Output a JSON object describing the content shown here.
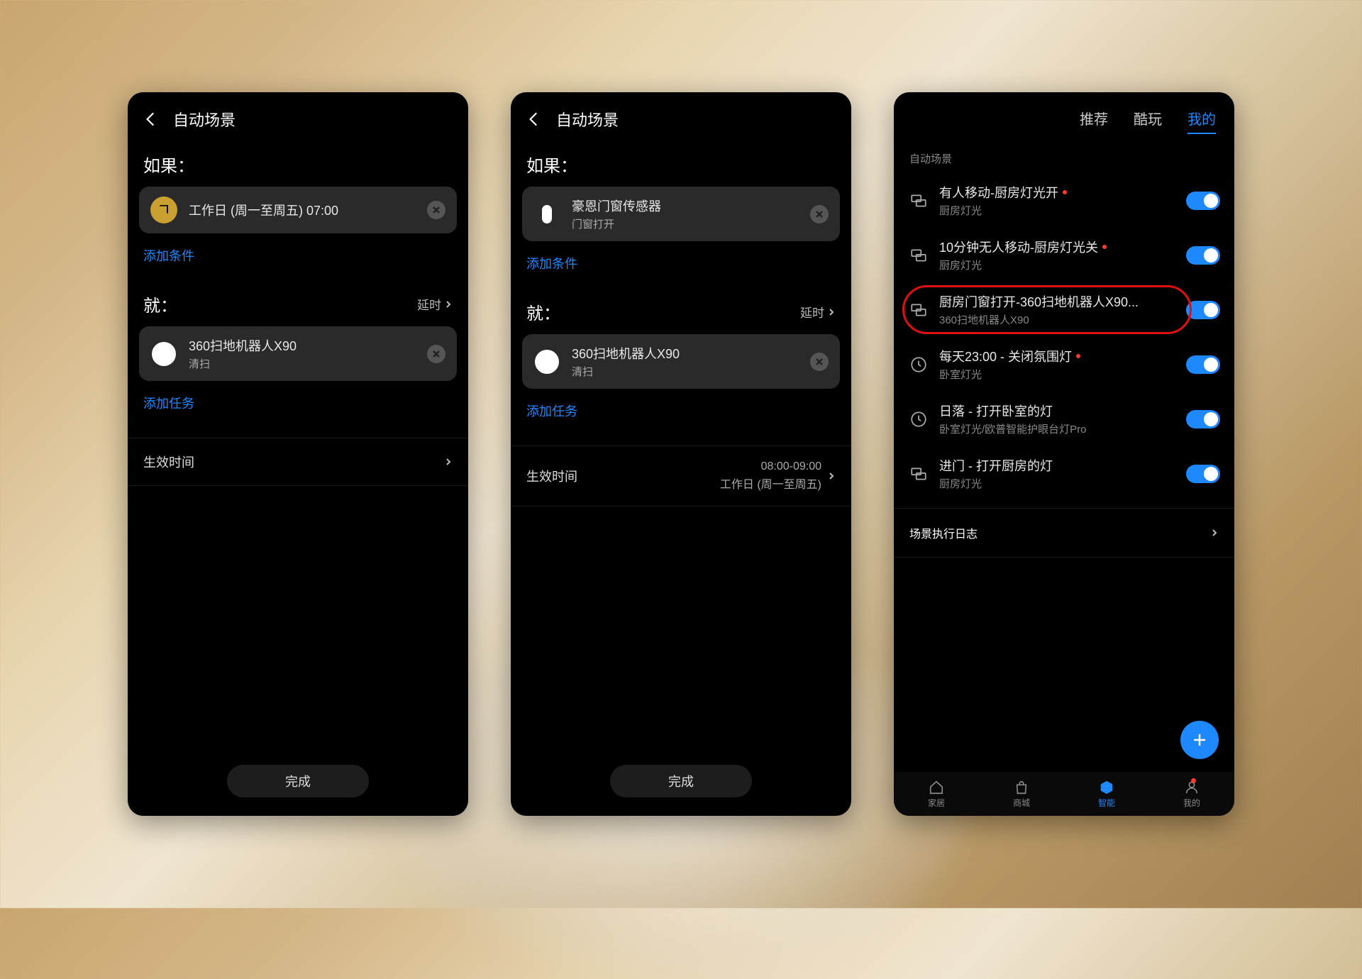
{
  "screen1": {
    "header": "自动场景",
    "if_label": "如果：",
    "condition": {
      "title": "工作日 (周一至周五) 07:00"
    },
    "add_condition": "添加条件",
    "then_label": "就：",
    "delay_label": "延时",
    "task": {
      "title": "360扫地机器人X90",
      "sub": "清扫"
    },
    "add_task": "添加任务",
    "effective_label": "生效时间",
    "done": "完成"
  },
  "screen2": {
    "header": "自动场景",
    "if_label": "如果：",
    "condition": {
      "title": "豪恩门窗传感器",
      "sub": "门窗打开"
    },
    "add_condition": "添加条件",
    "then_label": "就：",
    "delay_label": "延时",
    "task": {
      "title": "360扫地机器人X90",
      "sub": "清扫"
    },
    "add_task": "添加任务",
    "effective_label": "生效时间",
    "effective_time": "08:00-09:00",
    "effective_days": "工作日 (周一至周五)",
    "done": "完成"
  },
  "screen3": {
    "tabs": {
      "recommend": "推荐",
      "cool": "酷玩",
      "mine": "我的"
    },
    "section": "自动场景",
    "scenes": [
      {
        "title": "有人移动-厨房灯光开",
        "sub": "厨房灯光",
        "icon": "link",
        "dot": true
      },
      {
        "title": "10分钟无人移动-厨房灯光关",
        "sub": "厨房灯光",
        "icon": "link",
        "dot": true
      },
      {
        "title": "厨房门窗打开-360扫地机器人X90...",
        "sub": "360扫地机器人X90",
        "icon": "link",
        "dot": false,
        "highlight": true
      },
      {
        "title": "每天23:00 - 关闭氛围灯",
        "sub": "卧室灯光",
        "icon": "clock",
        "dot": true
      },
      {
        "title": "日落 - 打开卧室的灯",
        "sub": "卧室灯光/欧普智能护眼台灯Pro",
        "icon": "clock",
        "dot": false
      },
      {
        "title": "进门 - 打开厨房的灯",
        "sub": "厨房灯光",
        "icon": "link",
        "dot": false
      }
    ],
    "log_label": "场景执行日志",
    "nav": {
      "home": "家居",
      "mall": "商城",
      "smart": "智能",
      "me": "我的"
    }
  }
}
